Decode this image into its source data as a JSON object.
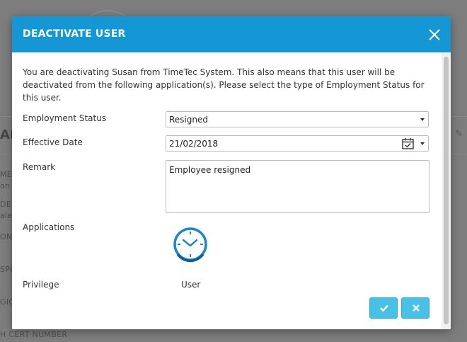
{
  "background": {
    "title_fragment": "AI",
    "fragments": [
      "ME",
      "an",
      "DER",
      "ale",
      "ON",
      "SPO",
      "GIO",
      "H CERT NUMBER"
    ]
  },
  "modal": {
    "title": "DEACTIVATE USER",
    "header_color": "#1497d4",
    "intro_text": "You are deactivating Susan from TimeTec System. This also means that this user will be deactivated from the following application(s). Please select the type of Employment Status for this user.",
    "fields": {
      "employment_status": {
        "label": "Employment Status",
        "value": "Resigned"
      },
      "effective_date": {
        "label": "Effective Date",
        "value": "21/02/2018"
      },
      "remark": {
        "label": "Remark",
        "value": "Employee resigned"
      },
      "applications": {
        "label": "Applications",
        "icon": "clock-icon"
      },
      "privilege": {
        "label": "Privilege",
        "value": "User"
      }
    },
    "buttons": {
      "confirm": {
        "icon": "check-icon",
        "color": "#47c1e6"
      },
      "cancel": {
        "icon": "x-icon",
        "color": "#47c1e6"
      }
    }
  }
}
